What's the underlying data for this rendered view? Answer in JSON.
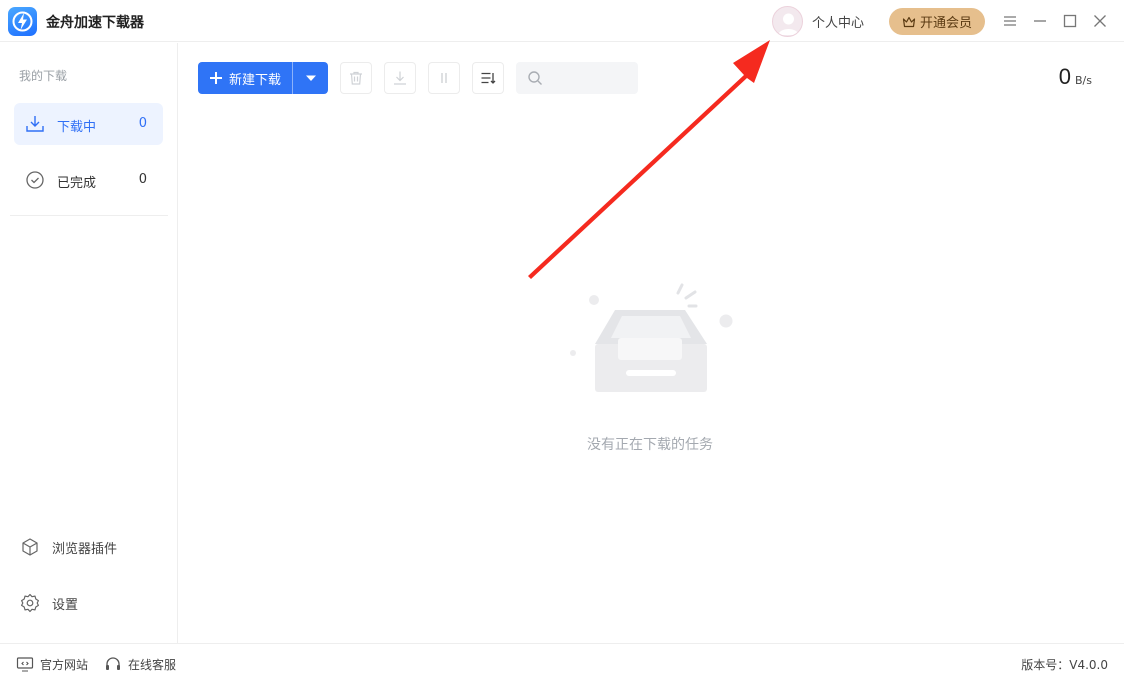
{
  "app": {
    "title": "金舟加速下载器",
    "logo_icon": "lightning-bolt-icon"
  },
  "header": {
    "user_center_label": "个人中心",
    "vip_label": "开通会员",
    "vip_icon": "crown-icon",
    "controls": [
      "menu-icon",
      "minimize-icon",
      "maximize-icon",
      "close-icon"
    ]
  },
  "sidebar": {
    "section_label": "我的下载",
    "items": [
      {
        "label": "下载中",
        "count": "0",
        "icon": "download-icon",
        "active": true
      },
      {
        "label": "已完成",
        "count": "0",
        "icon": "check-circle-icon",
        "active": false
      }
    ],
    "bottom_items": [
      {
        "label": "浏览器插件",
        "icon": "cube-icon"
      },
      {
        "label": "设置",
        "icon": "gear-icon"
      }
    ]
  },
  "toolbar": {
    "new_download_label": "新建下载",
    "search_placeholder": "",
    "speed_value": "0",
    "speed_unit": "B/s"
  },
  "main": {
    "empty_text": "没有正在下载的任务"
  },
  "footer": {
    "website_label": "官方网站",
    "support_label": "在线客服",
    "version_label": "版本号：V4.0.0"
  },
  "colors": {
    "accent": "#2f74f6",
    "vip": "#e6bf8d",
    "arrow": "#f52a1f"
  }
}
